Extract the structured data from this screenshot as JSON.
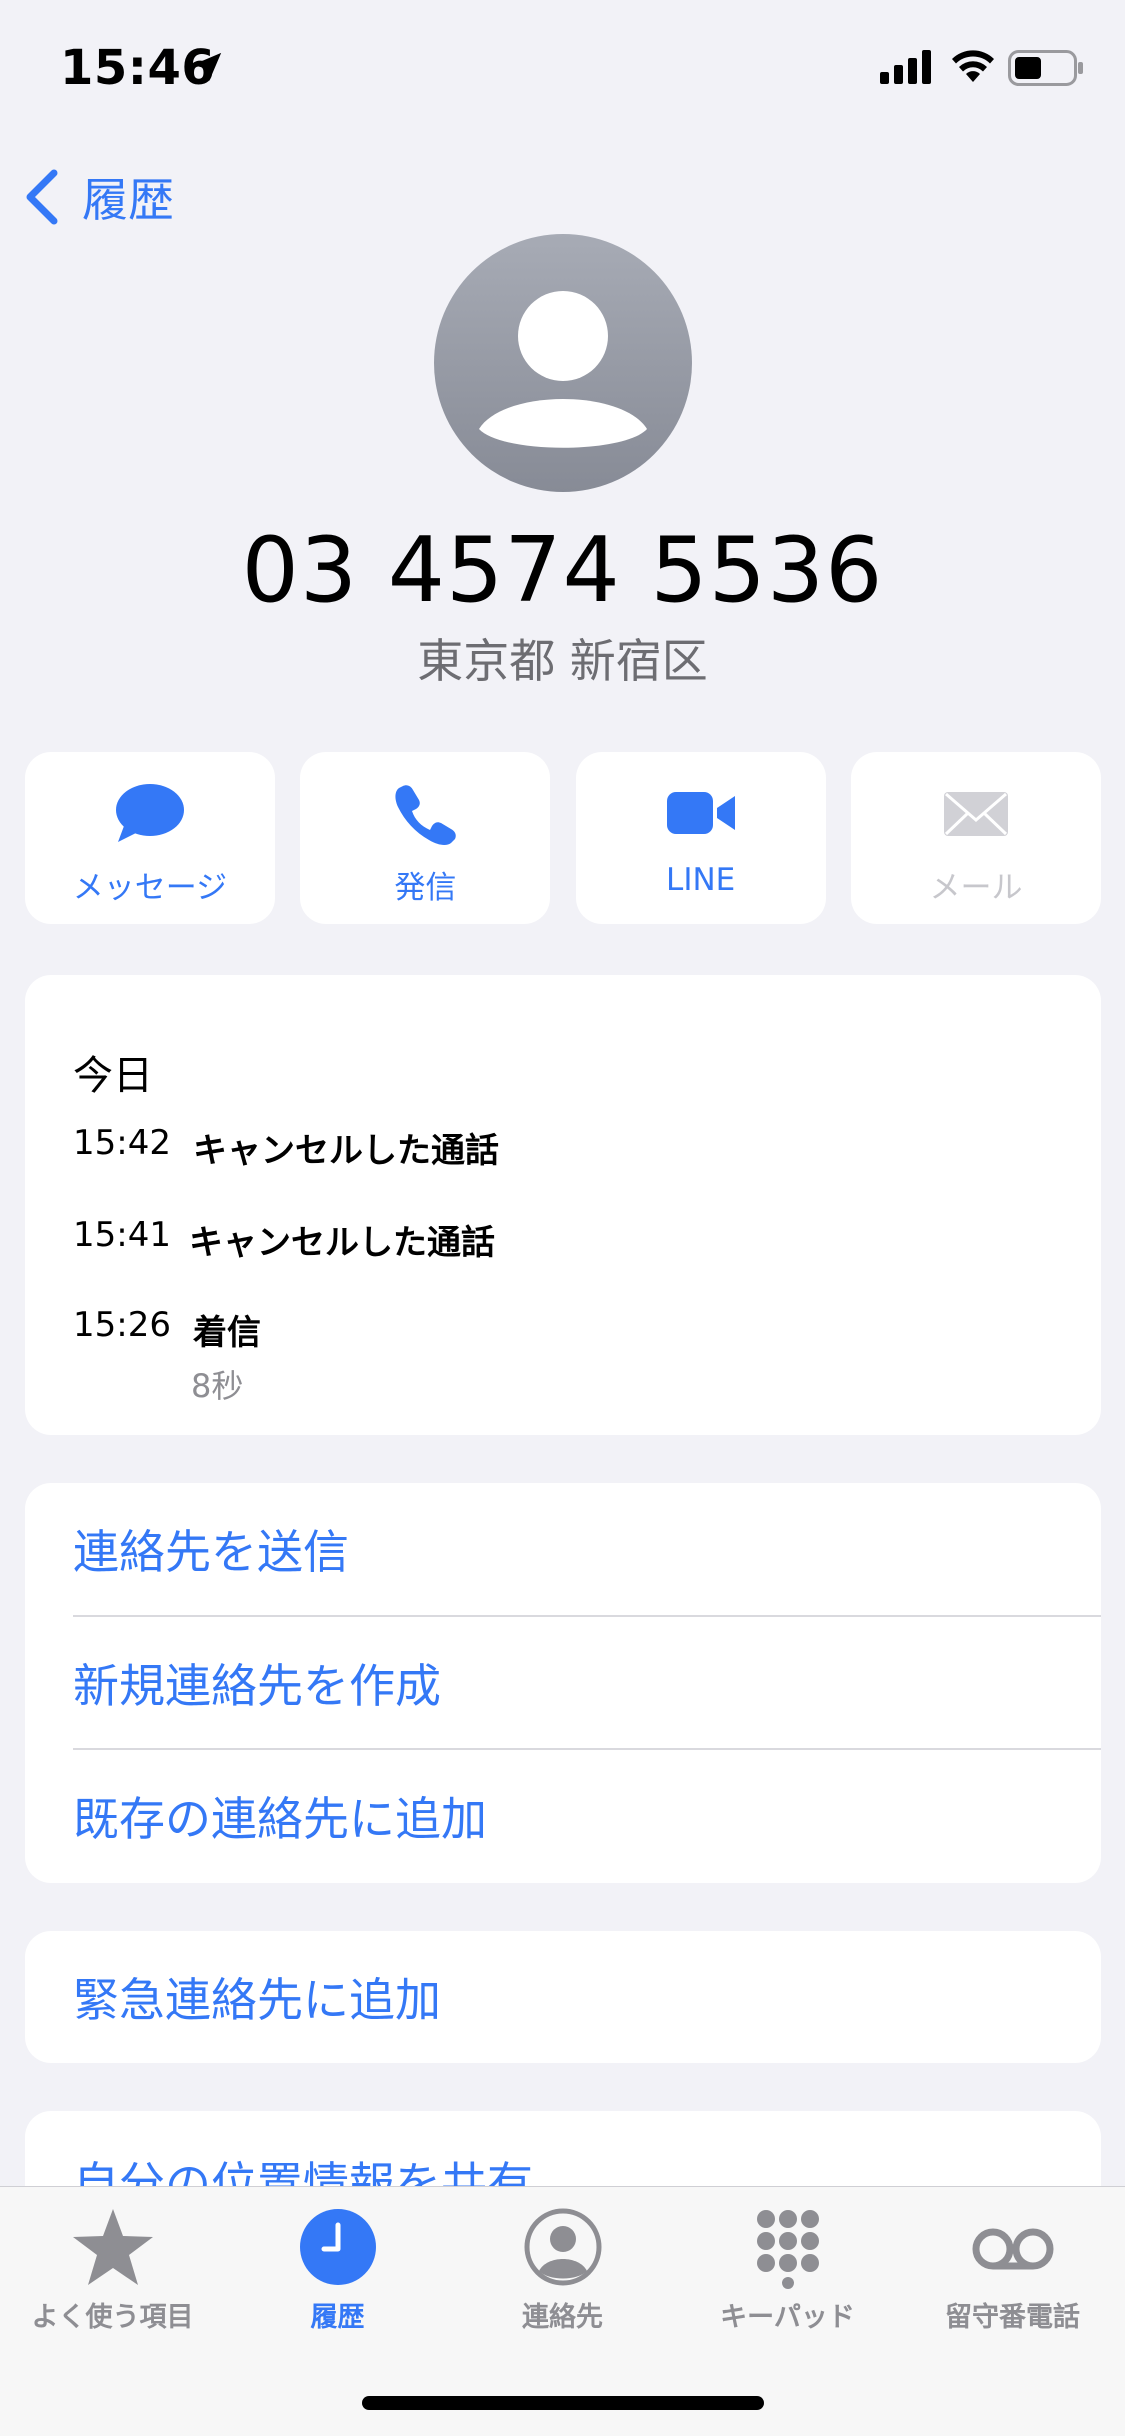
{
  "status_bar": {
    "time": "15:46"
  },
  "nav": {
    "back_label": "履歴"
  },
  "contact": {
    "phone_number": "03 4574 5536",
    "location": "東京都 新宿区"
  },
  "actions": [
    {
      "label": "メッセージ",
      "icon": "message-bubble-icon",
      "enabled": true
    },
    {
      "label": "発信",
      "icon": "phone-icon",
      "enabled": true
    },
    {
      "label": "LINE",
      "icon": "video-camera-icon",
      "enabled": true
    },
    {
      "label": "メール",
      "icon": "mail-icon",
      "enabled": false
    }
  ],
  "history": {
    "heading": "今日",
    "calls": [
      {
        "time": "15:42",
        "type": "キャンセルした通話"
      },
      {
        "time": "15:41",
        "type": "キャンセルした通話"
      },
      {
        "time": "15:26",
        "type": "着信",
        "duration": "8秒"
      }
    ]
  },
  "contact_options": [
    "連絡先を送信",
    "新規連絡先を作成",
    "既存の連絡先に追加"
  ],
  "emergency": {
    "label": "緊急連絡先に追加"
  },
  "share_location": {
    "label": "自分の位置情報を共有"
  },
  "tabs": [
    {
      "label": "よく使う項目",
      "icon": "star-icon",
      "active": false
    },
    {
      "label": "履歴",
      "icon": "clock-icon",
      "active": true
    },
    {
      "label": "連絡先",
      "icon": "contact-icon",
      "active": false
    },
    {
      "label": "キーパッド",
      "icon": "keypad-icon",
      "active": false
    },
    {
      "label": "留守番電話",
      "icon": "voicemail-icon",
      "active": false
    }
  ],
  "colors": {
    "accent": "#3478F6",
    "background": "#F2F2F7",
    "secondary_text": "#8E8E93",
    "disabled": "#C7C7CC"
  }
}
